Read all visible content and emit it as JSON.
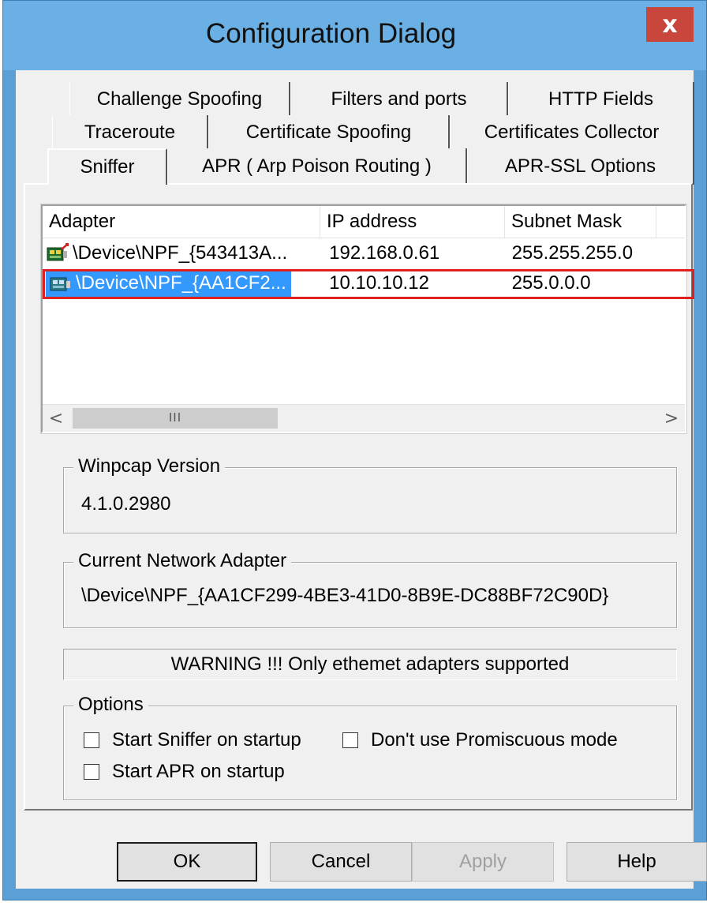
{
  "window": {
    "title": "Configuration Dialog",
    "close_glyph": "x"
  },
  "tabs": {
    "row1": [
      "Challenge Spoofing",
      "Filters and ports",
      "HTTP Fields"
    ],
    "row2": [
      "Traceroute",
      "Certificate Spoofing",
      "Certificates Collector"
    ],
    "row3": [
      "Sniffer",
      "APR ( Arp Poison Routing )",
      "APR-SSL Options"
    ],
    "active": "Sniffer"
  },
  "adapters": {
    "columns": [
      "Adapter",
      "IP address",
      "Subnet Mask"
    ],
    "rows": [
      {
        "adapter": "\\Device\\NPF_{543413A...",
        "ip": "192.168.0.61",
        "mask": "255.255.255.0",
        "icon": "network-adapter-icon",
        "selected": false
      },
      {
        "adapter": "\\Device\\NPF_{AA1CF2...",
        "ip": "10.10.10.12",
        "mask": "255.0.0.0",
        "icon": "network-adapter-icon",
        "selected": true
      }
    ],
    "scroll_left": "<",
    "scroll_right": ">",
    "scroll_grip": "III"
  },
  "winpcap": {
    "label": "Winpcap Version",
    "value": "4.1.0.2980"
  },
  "current_adapter": {
    "label": "Current Network Adapter",
    "value": "\\Device\\NPF_{AA1CF299-4BE3-41D0-8B9E-DC88BF72C90D}"
  },
  "warning": "WARNING !!! Only ethemet adapters supported",
  "options": {
    "label": "Options",
    "start_sniffer": {
      "label": "Start Sniffer on startup",
      "checked": false
    },
    "no_promiscuous": {
      "label": "Don't use Promiscuous mode",
      "checked": false
    },
    "start_apr": {
      "label": "Start APR on startup",
      "checked": false
    }
  },
  "buttons": {
    "ok": "OK",
    "cancel": "Cancel",
    "apply": "Apply",
    "help": "Help"
  },
  "colors": {
    "selection": "#3399ff",
    "highlight_outline": "#e02020",
    "titlebar": "#6ab0e4",
    "close": "#c9463d"
  }
}
